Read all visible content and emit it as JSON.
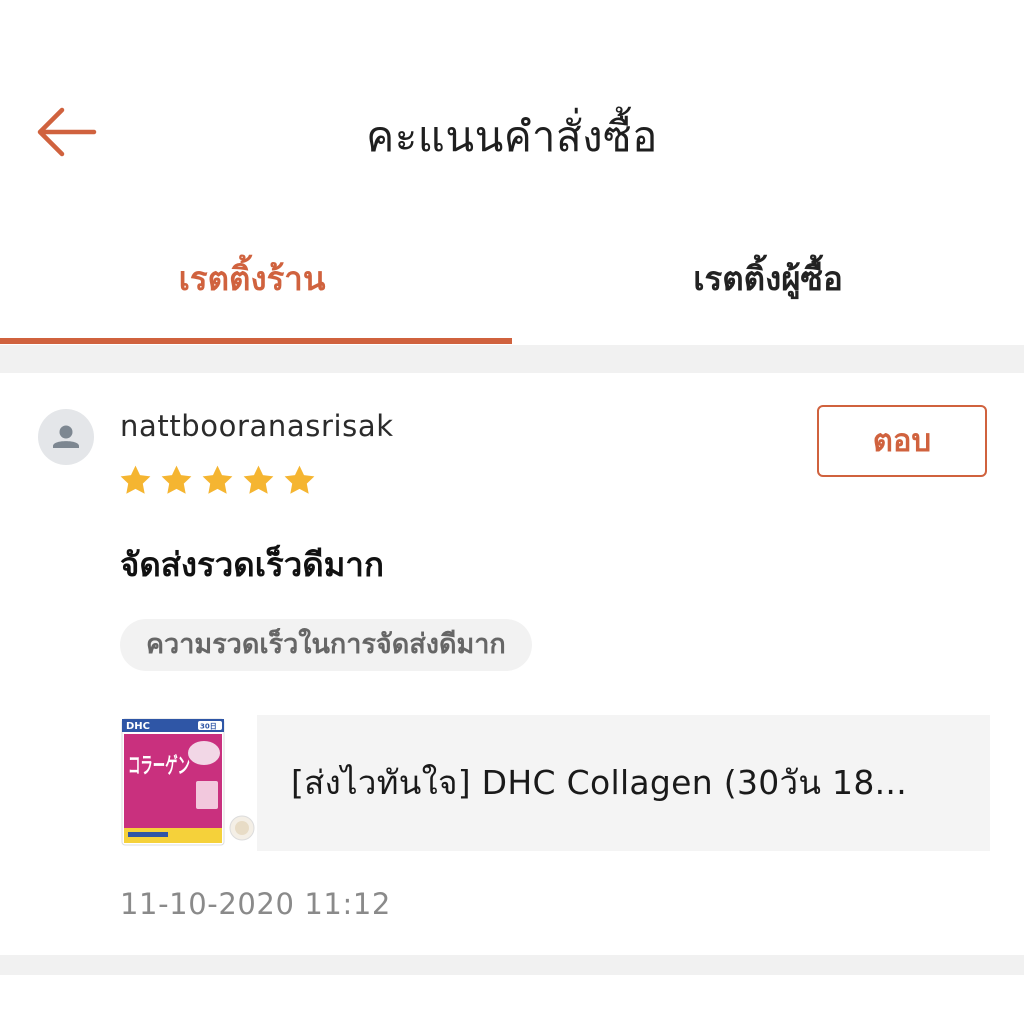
{
  "colors": {
    "accent": "#d0623e",
    "star": "#f5b531",
    "text_primary": "#222222",
    "text_muted": "#8a8a8a",
    "band": "#f1f1f1"
  },
  "header": {
    "back_icon": "arrow-left-icon",
    "title": "คะแนนคำสั่งซื้อ"
  },
  "tabs": [
    {
      "label": "เรตติ้งร้าน",
      "active": true
    },
    {
      "label": "เรตติ้งผู้ซื้อ",
      "active": false
    }
  ],
  "review": {
    "avatar_icon": "user-icon",
    "username": "nattbooranasrisak",
    "rating": 5,
    "rating_max": 5,
    "reply_label": "ตอบ",
    "text": "จัดส่งรวดเร็วดีมาก",
    "tag": "ความรวดเร็วในการจัดส่งดีมาก",
    "product": {
      "name": "[ส่งไวทันใจ] DHC Collagen (30วัน 18...",
      "thumb_brand": "DHC",
      "thumb_badge": "30日",
      "thumb_title": "コラーゲン"
    },
    "timestamp": "11-10-2020 11:12"
  }
}
